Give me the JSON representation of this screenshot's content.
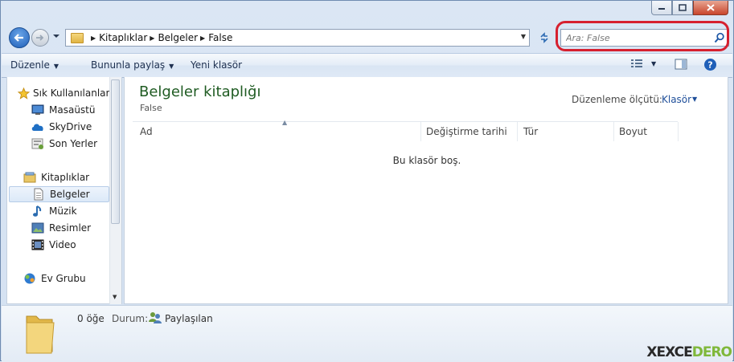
{
  "breadcrumb": {
    "items": [
      "Kitaplıklar",
      "Belgeler",
      "False"
    ]
  },
  "search": {
    "placeholder": "Ara: False"
  },
  "toolbar": {
    "organize": "Düzenle",
    "share_with": "Bununla paylaş",
    "new_folder": "Yeni klasör"
  },
  "sidebar": {
    "favorites_header": "Sık Kullanılanlar",
    "favorites": [
      "Masaüstü",
      "SkyDrive",
      "Son Yerler"
    ],
    "libraries_header": "Kitaplıklar",
    "libraries": [
      "Belgeler",
      "Müzik",
      "Resimler",
      "Video"
    ],
    "homegroup": "Ev Grubu",
    "selected": "Belgeler"
  },
  "main": {
    "library_title": "Belgeler kitaplığı",
    "library_subtitle": "False",
    "arrange_label": "Düzenleme ölçütü:",
    "arrange_value": "Klasör",
    "columns": [
      "Ad",
      "Değiştirme tarihi",
      "Tür",
      "Boyut"
    ],
    "empty_text": "Bu klasör boş."
  },
  "details": {
    "item_count": "0 öğe",
    "state_label": "Durum:",
    "state_value": "Paylaşılan"
  },
  "watermark": {
    "part1": "XEXCE",
    "part2": "DERO"
  },
  "colors": {
    "accent": "#1f5fb8",
    "title_green": "#1f5b22",
    "highlight_red": "#d6202f"
  }
}
